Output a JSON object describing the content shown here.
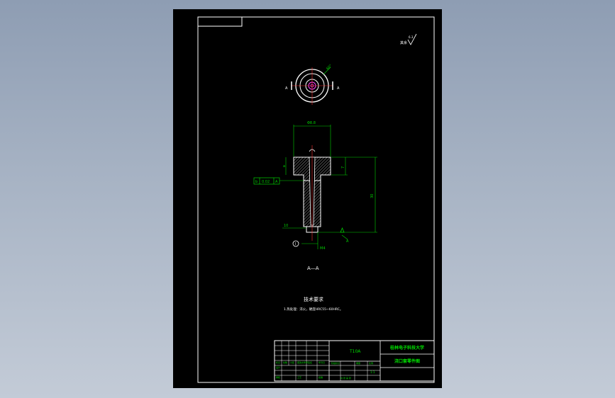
{
  "drawing": {
    "surface_symbol": "其余",
    "roughness_value": "6.3",
    "angle_label": "60°",
    "section_marker": "A",
    "section_title": "A—A",
    "dim_diameter": "Φ8.8",
    "dim_depth": "30",
    "dim_head": "7",
    "tol_left": "a",
    "tol_box_symbol": "b",
    "tol_box_text": "0.02",
    "tol_box_ref": "A",
    "datum_label": "A",
    "detail_balloon": "I",
    "small_dim_left": "10",
    "small_dim_bottom": "M4",
    "note_heading": "技术要求",
    "note_text": "1.热处理：淬火，硬度HRC55~60HRC。"
  },
  "title_block": {
    "material": "T10A",
    "school": "桂林电子科技大学",
    "part_name": "浇口套零件图",
    "row_labels": [
      "标记",
      "处数",
      "分区",
      "更改文件号",
      "签名",
      "年月日"
    ],
    "roles": [
      "设计",
      "审核",
      "工艺",
      "批准"
    ],
    "stage_labels": [
      "阶段标记",
      "重量",
      "比例"
    ],
    "scale": "1:1",
    "sheet": "共 张 第 张"
  },
  "colors": {
    "paper": "#000000",
    "frame": "#ffffff",
    "dimension": "#00d000",
    "centerline": "#ff3030",
    "detail": "#ff40ff",
    "title_text": "#00e000"
  }
}
